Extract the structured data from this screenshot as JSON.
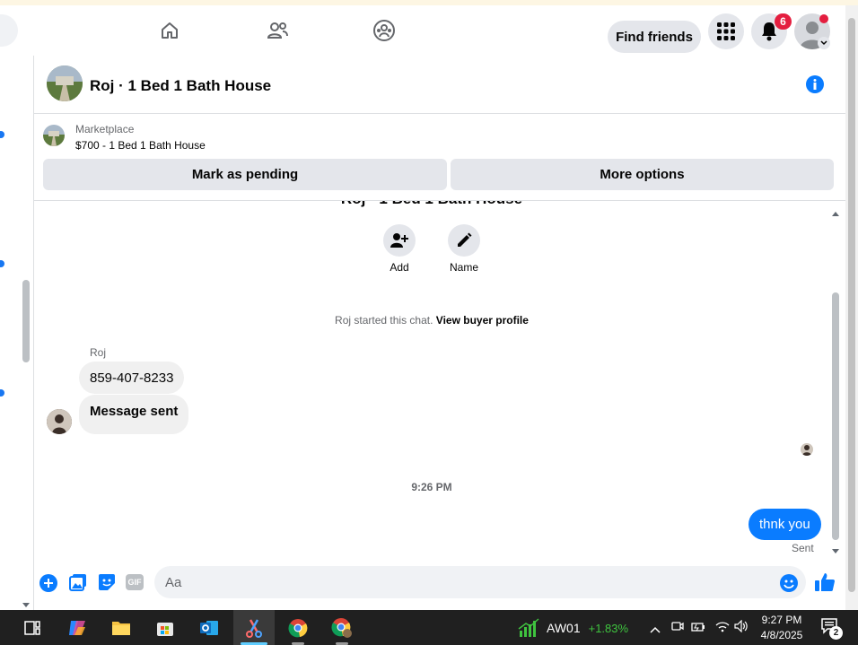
{
  "topbar": {
    "find_friends": "Find friends",
    "notification_count": "6"
  },
  "conversation": {
    "title": "Roj · 1 Bed 1 Bath House",
    "title_faded": "Roj · 1 Bed 1 Bath House"
  },
  "listing": {
    "source": "Marketplace",
    "price_title": "$700 - 1 Bed 1 Bath House",
    "mark_pending": "Mark as pending",
    "more_options": "More options"
  },
  "chat_actions": {
    "add": "Add",
    "name": "Name"
  },
  "system_message": {
    "text": "Roj started this chat.",
    "link": "View buyer profile"
  },
  "messages": {
    "sender": "Roj",
    "incoming": [
      "859-407-8233",
      "Message sent"
    ],
    "timestamp": "9:26 PM",
    "outgoing": "thnk you",
    "status": "Sent"
  },
  "composer": {
    "placeholder": "Aa",
    "gif": "GIF"
  },
  "taskbar": {
    "ticker": "AW01",
    "change": "+1.83%",
    "time": "9:27 PM",
    "date": "4/8/2025",
    "notif_count": "2"
  },
  "colors": {
    "accent": "#0a7cff",
    "fb_blue": "#1877f2",
    "positive": "#3fc43f"
  }
}
